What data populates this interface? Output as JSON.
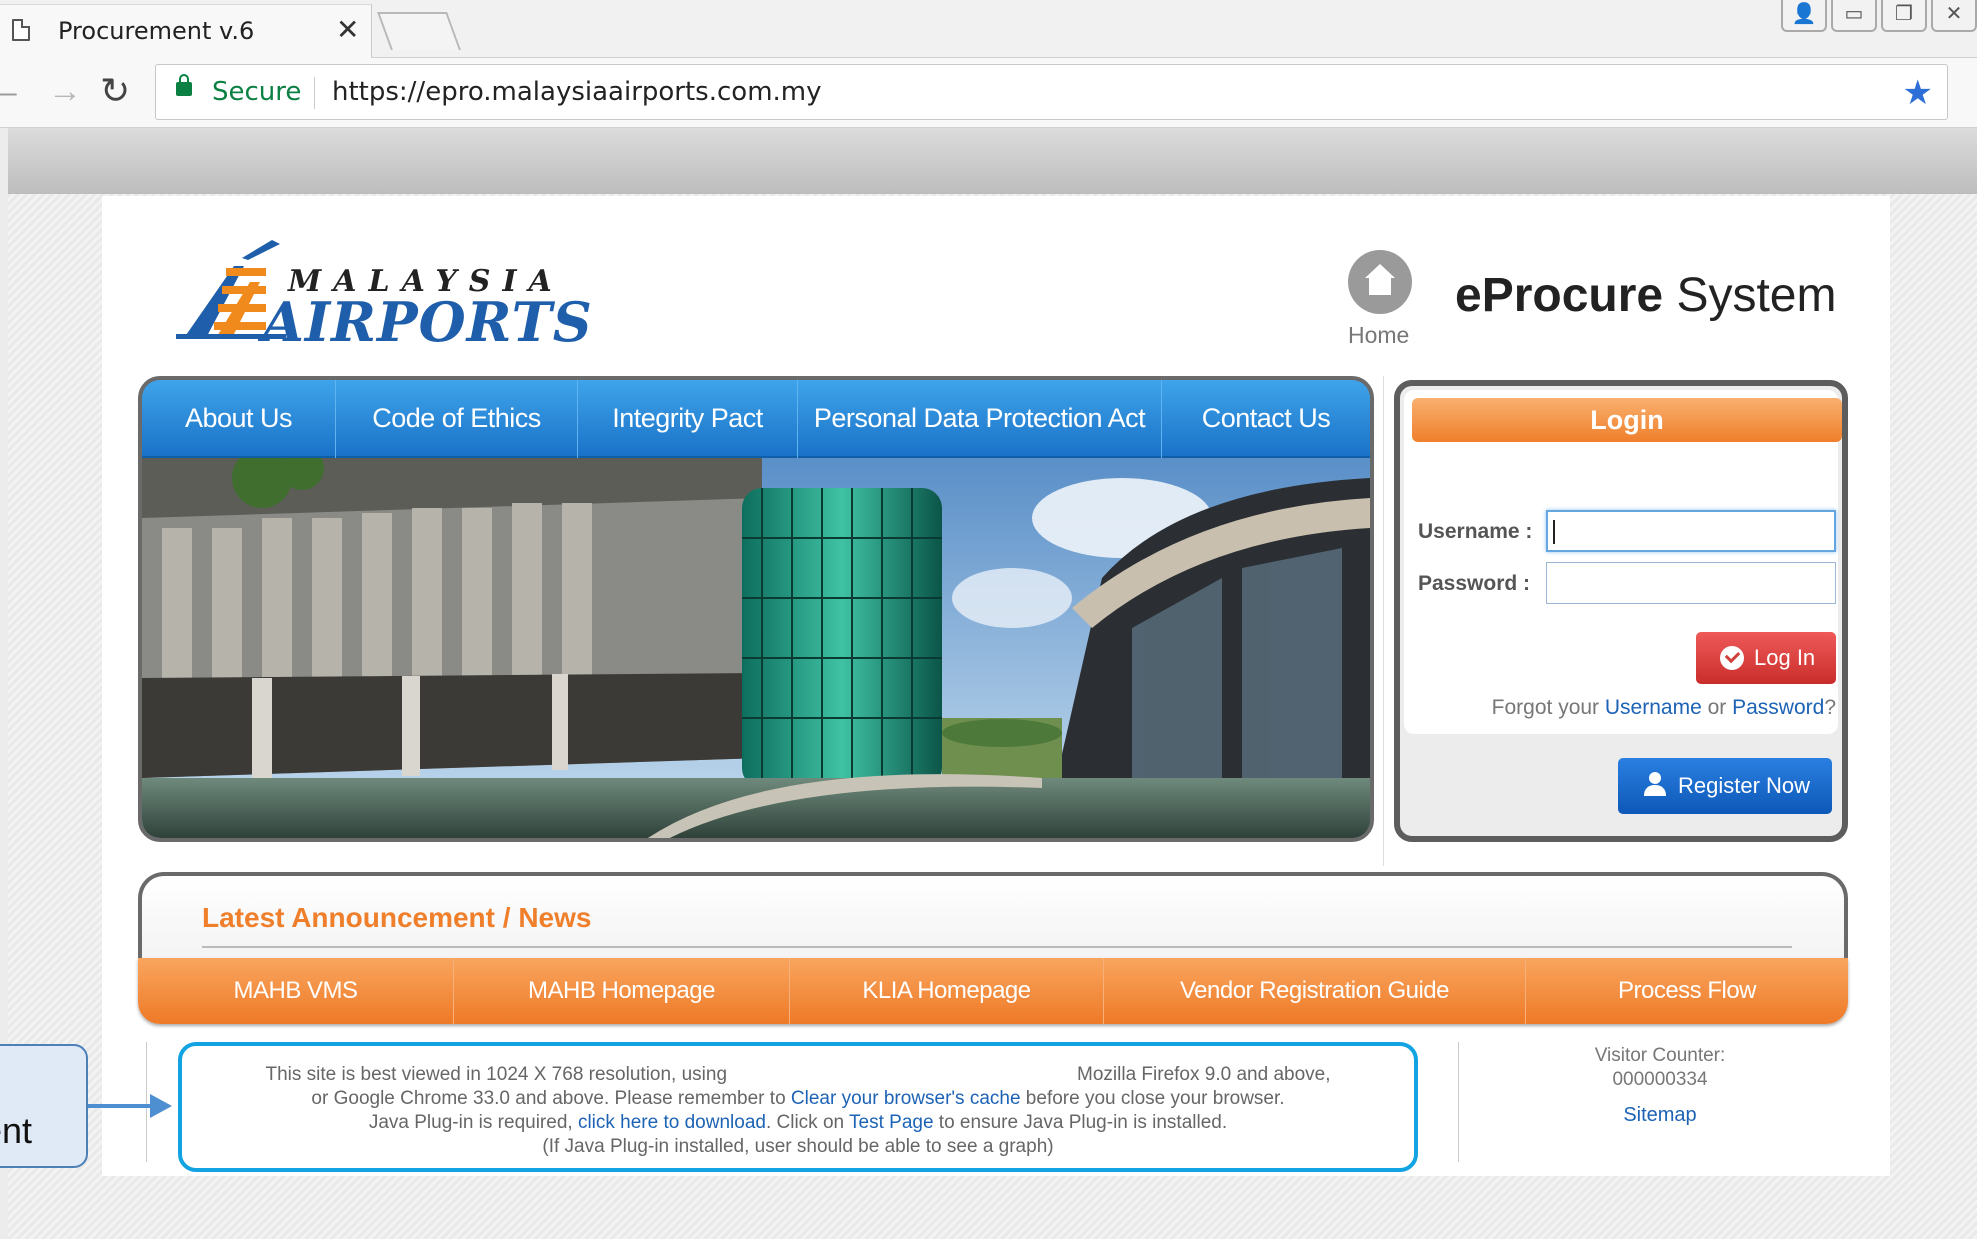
{
  "browser": {
    "tab_title": "Procurement v.6",
    "tab_close": "✕",
    "secure_label": "Secure",
    "url": "https://epro.malaysiaairports.com.my",
    "window_buttons": [
      "👤",
      "▭",
      "❐",
      "✕"
    ]
  },
  "header": {
    "logo_line1": "MALAYSIA",
    "logo_line2": "AIRPORTS",
    "home_label": "Home",
    "system_title_bold": "eProcure",
    "system_title_rest": " System"
  },
  "nav": {
    "items": [
      "About Us",
      "Code of Ethics",
      "Integrity Pact",
      "Personal Data Protection Act",
      "Contact Us"
    ]
  },
  "login": {
    "heading": "Login",
    "username_label": "Username :",
    "password_label": "Password :",
    "username_value": "",
    "password_value": "",
    "login_button": "Log In",
    "forgot_prefix": "Forgot your ",
    "forgot_username": "Username",
    "forgot_or": " or ",
    "forgot_password": "Password",
    "forgot_suffix": "?",
    "register_button": "Register Now"
  },
  "announcement": {
    "title": "Latest Announcement / News"
  },
  "footer_nav": {
    "items": [
      "MAHB VMS",
      "MAHB Homepage",
      "KLIA Homepage",
      "Vendor Registration Guide",
      "Process Flow"
    ]
  },
  "footer_info": {
    "line1_a": "This site is best viewed in 1024 X 768 resolution, using",
    "line1_b": "Mozilla Firefox 9.0 and above,",
    "line2_a": "or Google Chrome 33.0 and above. Please remember to ",
    "line2_link": "Clear your browser's cache",
    "line2_b": " before you close your browser.",
    "line3_a": "Java Plug-in is required, ",
    "line3_link1": "click here to download",
    "line3_b": ". Click on ",
    "line3_link2": "Test Page",
    "line3_c": " to ensure Java Plug-in is installed.",
    "line4": "(If Java Plug-in installed, user should be able to see a graph)",
    "visitor_label": "Visitor Counter:",
    "visitor_count": "000000334",
    "sitemap": "Sitemap"
  },
  "callout": {
    "text": "ent"
  },
  "colors": {
    "nav_blue": "#1a72c8",
    "accent_orange": "#ef7f2b",
    "login_red": "#c92d2b",
    "register_blue": "#0d58b8",
    "highlight_cyan": "#12a3e3"
  }
}
